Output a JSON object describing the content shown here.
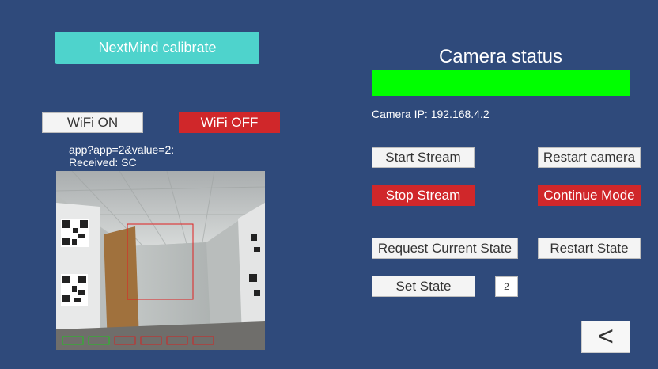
{
  "nextmind": {
    "calibrate_label": "NextMind calibrate"
  },
  "wifi": {
    "on_label": "WiFi ON",
    "off_label": "WiFi OFF"
  },
  "app": {
    "request_text": "app?app=2&value=2:",
    "received_text": "Received: SC"
  },
  "camera": {
    "status_title": "Camera status",
    "status_color": "#00ff00",
    "ip_text": "Camera IP: 192.168.4.2"
  },
  "buttons": {
    "start_stream": "Start Stream",
    "restart_camera": "Restart camera",
    "stop_stream": "Stop Stream",
    "continue_mode": "Continue Mode",
    "request_current_state": "Request Current State",
    "restart_state": "Restart State",
    "set_state": "Set State",
    "back": "<"
  },
  "state": {
    "value": "2"
  },
  "icons": {
    "back": "chevron-left-icon"
  }
}
